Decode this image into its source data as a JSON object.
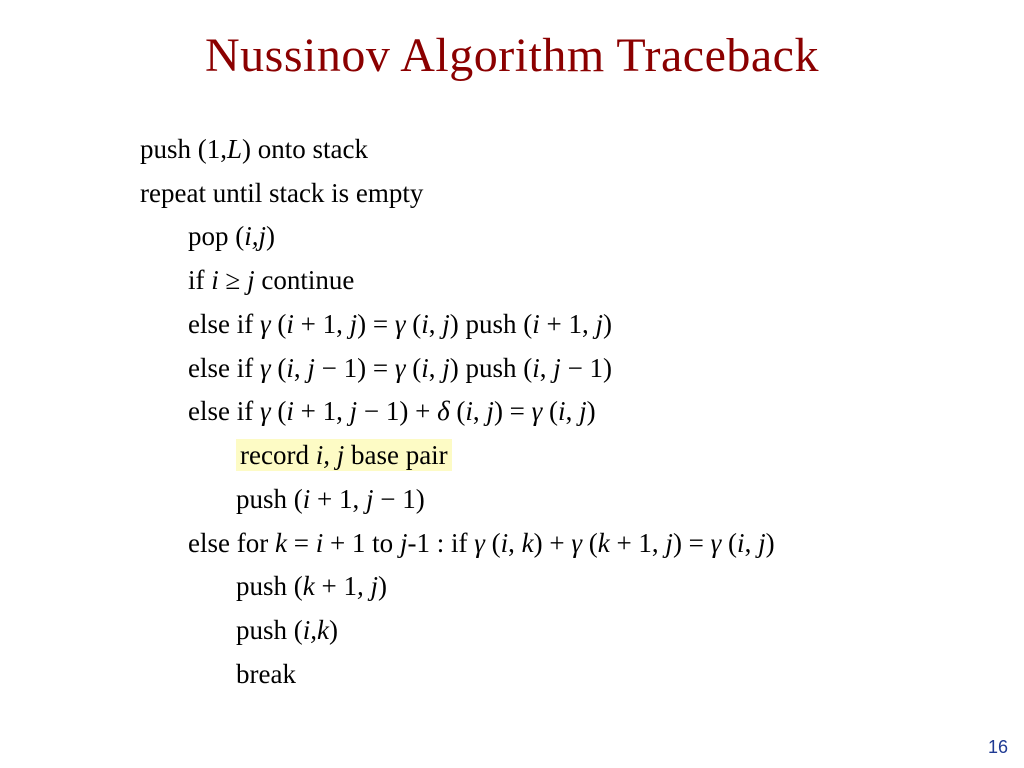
{
  "title": "Nussinov Algorithm Traceback",
  "lines": {
    "l1_a": "push (1,",
    "l1_b": "L",
    "l1_c": ") onto stack",
    "l2": "repeat until stack is empty",
    "l3_a": "pop (",
    "l3_b": "i,j",
    "l3_c": ")",
    "l4_a": "if ",
    "l4_b": "i",
    "l4_c": "  ≥  ",
    "l4_d": "j",
    "l4_e": " continue",
    "l5_a": "else if  ",
    "l5_b": "γ",
    "l5_c": " (",
    "l5_d": "i",
    "l5_e": " + 1, ",
    "l5_f": "j",
    "l5_g": ")  =  ",
    "l5_h": "γ",
    "l5_i": " (",
    "l5_j": "i",
    "l5_k": ", ",
    "l5_l": "j",
    "l5_m": ")  push (",
    "l5_n": "i",
    "l5_o": " + 1, ",
    "l5_p": "j",
    "l5_q": ")",
    "l6_a": "else if  ",
    "l6_b": "γ",
    "l6_c": " (",
    "l6_d": "i",
    "l6_e": ", ",
    "l6_f": "j",
    "l6_g": " − 1)  =  ",
    "l6_h": "γ",
    "l6_i": " (",
    "l6_j": "i",
    "l6_k": ", ",
    "l6_l": "j",
    "l6_m": ")  push (",
    "l6_n": "i",
    "l6_o": ", ",
    "l6_p": "j",
    "l6_q": " − 1)",
    "l7_a": "else if  ",
    "l7_b": "γ",
    "l7_c": " (",
    "l7_d": "i",
    "l7_e": " + 1, ",
    "l7_f": "j",
    "l7_g": " − 1) + ",
    "l7_h": "δ",
    "l7_i": " (",
    "l7_j": "i",
    "l7_k": ", ",
    "l7_l": "j",
    "l7_m": ")  =  ",
    "l7_n": "γ",
    "l7_o": " (",
    "l7_p": "i",
    "l7_q": ", ",
    "l7_r": "j",
    "l7_s": ")",
    "l8_a": "record ",
    "l8_b": "i, j",
    "l8_c": " base pair",
    "l9_a": "push (",
    "l9_b": "i",
    "l9_c": " + 1, ",
    "l9_d": "j",
    "l9_e": " − 1)",
    "l10_a": "else for ",
    "l10_b": "k",
    "l10_c": " = ",
    "l10_d": "i",
    "l10_e": " + 1 to  ",
    "l10_f": "j",
    "l10_g": "-1 : if   ",
    "l10_h": "γ",
    "l10_i": " (",
    "l10_j": "i",
    "l10_k": ", ",
    "l10_l": "k",
    "l10_m": ") + ",
    "l10_n": "γ",
    "l10_o": " (",
    "l10_p": "k",
    "l10_q": " + 1, ",
    "l10_r": "j",
    "l10_s": ")  =  ",
    "l10_t": "γ",
    "l10_u": " (",
    "l10_v": "i",
    "l10_w": ", ",
    "l10_x": "j",
    "l10_y": ")",
    "l11_a": "push (",
    "l11_b": "k",
    "l11_c": " + 1",
    "l11_d": ", j",
    "l11_e": ")",
    "l12_a": "push (",
    "l12_b": "i,k",
    "l12_c": ")",
    "l13": "break"
  },
  "page_number": "16"
}
